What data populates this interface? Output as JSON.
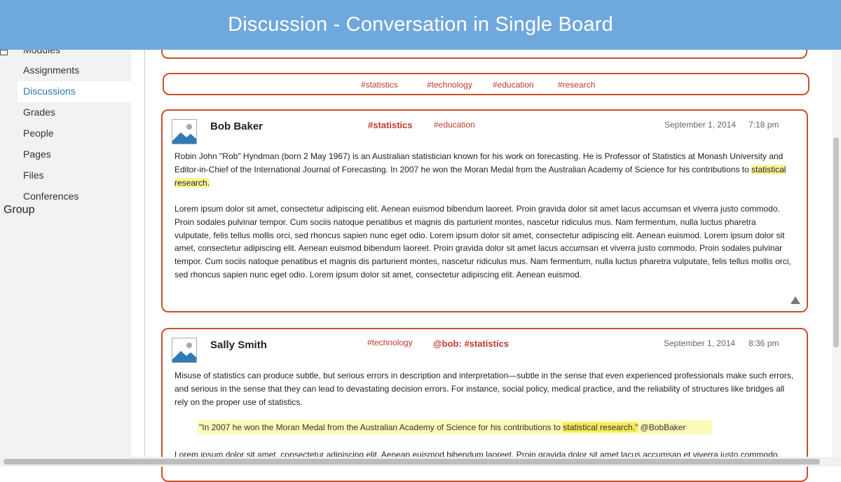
{
  "banner": {
    "title": "Discussion - Conversation in Single Board"
  },
  "sidebar": {
    "items": [
      {
        "label": "Modules"
      },
      {
        "label": "Assignments"
      },
      {
        "label": "Discussions"
      },
      {
        "label": "Grades"
      },
      {
        "label": "People"
      },
      {
        "label": "Pages"
      },
      {
        "label": "Files"
      },
      {
        "label": "Conferences"
      }
    ],
    "active": "Discussions",
    "group_label": "Group"
  },
  "tag_bar": {
    "tags": [
      "#statistics",
      "#technology",
      "#education",
      "#research"
    ]
  },
  "posts": [
    {
      "author": "Bob Baker",
      "tags": [
        "#statistics",
        "#education"
      ],
      "date": "September 1, 2014",
      "time": "7:18 pm",
      "paragraph1_plain": "Robin John \"Rob\" Hyndman (born 2 May 1967) is an Australian statistician known for his work on forecasting. He is Professor of Statistics at Monash University and Editor-in-Chief of the International Journal of Forecasting.  In 2007 he won the Moran Medal from the Australian Academy of Science for his contributions to",
      "paragraph1_highlight": "statistical research.",
      "paragraph2": "Lorem ipsum dolor sit amet, consectetur adipiscing elit. Aenean euismod bibendum laoreet. Proin gravida dolor sit amet lacus accumsan et viverra justo commodo. Proin sodales pulvinar tempor. Cum sociis natoque penatibus et magnis dis parturient montes, nascetur ridiculus mus. Nam fermentum, nulla luctus pharetra vulputate, felis tellus mollis orci, sed rhoncus sapien nunc eget odio.  Lorem ipsum dolor sit amet, consectetur adipiscing elit. Aenean euismod.  Lorem ipsum dolor sit amet, consectetur adipiscing elit. Aenean euismod bibendum laoreet. Proin gravida dolor sit amet lacus accumsan et viverra justo commodo. Proin sodales pulvinar tempor. Cum sociis natoque penatibus et magnis dis parturient montes, nascetur ridiculus mus. Nam fermentum, nulla luctus pharetra vulputate, felis tellus mollis orci, sed rhoncus sapien nunc eget odio.  Lorem ipsum dolor sit amet, consectetur adipiscing elit. Aenean euismod."
    },
    {
      "author": "Sally Smith",
      "tags": [
        "#technology",
        "@bob: #statistics"
      ],
      "date": "September 1, 2014",
      "time": "8:36 pm",
      "paragraph1": "Misuse of statistics can produce subtle, but serious errors in description and interpretation—subtle in the sense that even experienced professionals make such errors, and serious in the sense that they can lead to devastating decision errors. For instance, social policy, medical practice, and the reliability of structures like bridges all rely on the proper use of statistics.",
      "quote_plain": "\"In 2007 he won the Moran Medal from the Australian Academy of Science for his contributions to",
      "quote_highlight": "statistical research.\"",
      "quote_mention": "@BobBaker",
      "paragraph2": "Lorem ipsum dolor sit amet, consectetur adipiscing elit. Aenean euismod bibendum laoreet. Proin gravida dolor sit amet lacus accumsan et viverra justo commodo."
    }
  ],
  "colors": {
    "banner": "#6fa8dc",
    "border_accent": "#c8502c",
    "tag_text": "#c0392b",
    "highlight": "#fbf59a",
    "active_nav": "#2a7ab0"
  },
  "icons": [
    "calendar-icon",
    "image-placeholder-icon",
    "collapse-triangle-icon"
  ]
}
